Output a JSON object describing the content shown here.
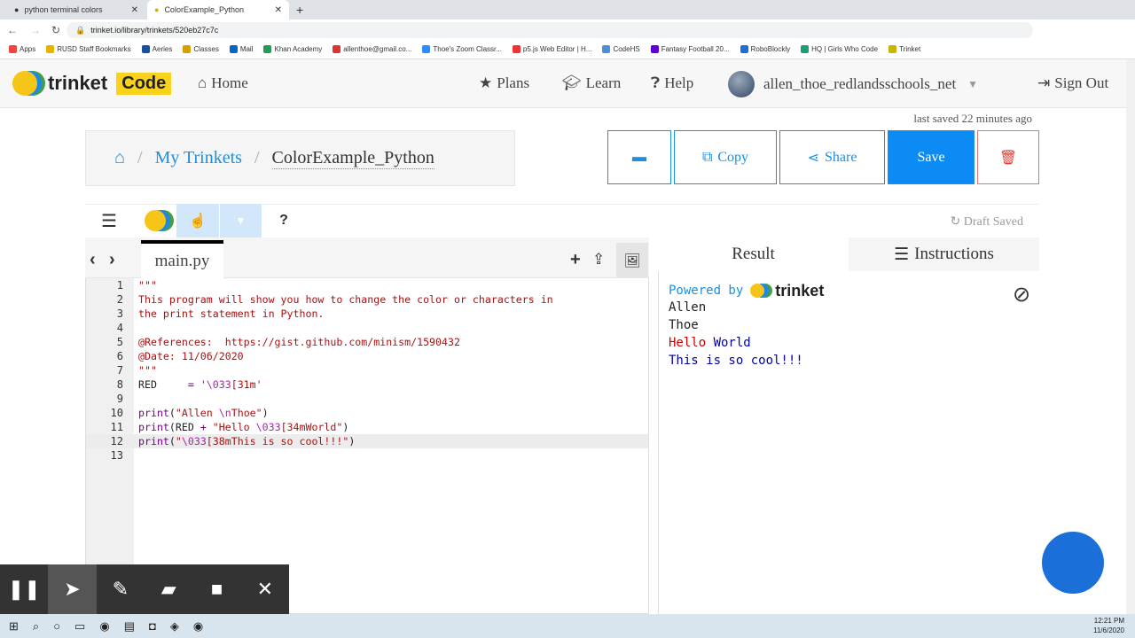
{
  "browser": {
    "tabs": [
      {
        "title": "python terminal colors",
        "icon": "github-icon"
      },
      {
        "title": "ColorExample_Python",
        "icon": "trinket-icon"
      }
    ],
    "url": "trinket.io/library/trinkets/520eb27c7c",
    "bookmarks": [
      "Apps",
      "RUSD Staff Bookmarks",
      "Aeries",
      "Classes",
      "Mail",
      "Khan Academy",
      "allenthoe@gmail.co...",
      "Thoe's Zoom Classr...",
      "p5.js Web Editor | H...",
      "CodeHS",
      "Fantasy Football 20...",
      "RoboBlockly",
      "HQ | Girls Who Code",
      "Trinket"
    ]
  },
  "header": {
    "logo": "trinket",
    "badge": "Code",
    "home": "Home",
    "plans": "Plans",
    "learn": "Learn",
    "help": "Help",
    "user": "allen_thoe_redlandsschools_net",
    "signout": "Sign Out"
  },
  "last_saved": "last saved 22 minutes ago",
  "breadcrumb": {
    "my": "My Trinkets",
    "current": "ColorExample_Python"
  },
  "actions": {
    "copy": "Copy",
    "share": "Share",
    "save": "Save"
  },
  "toolbar": {
    "help": "?",
    "draft": "Draft Saved"
  },
  "editor": {
    "file": "main.py",
    "highlighted_line": 12,
    "lines": [
      [
        [
          "s-str",
          "\"\"\""
        ]
      ],
      [
        [
          "s-str",
          "This program will show you how to change the color or characters in"
        ]
      ],
      [
        [
          "s-str",
          "the print statement in Python."
        ]
      ],
      [],
      [
        [
          "s-str",
          "@References:  https://gist.github.com/minism/1590432"
        ]
      ],
      [
        [
          "s-str",
          "@Date: 11/06/2020"
        ]
      ],
      [
        [
          "s-str",
          "\"\"\""
        ]
      ],
      [
        [
          "s-plain",
          "RED     "
        ],
        [
          "s-op",
          "= "
        ],
        [
          "s-str",
          "'"
        ],
        [
          "s-esc",
          "\\033"
        ],
        [
          "s-str",
          "[31m'"
        ]
      ],
      [],
      [
        [
          "s-kw",
          "print"
        ],
        [
          "s-plain",
          "("
        ],
        [
          "s-str",
          "\"Allen "
        ],
        [
          "s-esc",
          "\\n"
        ],
        [
          "s-str",
          "Thoe\""
        ],
        [
          "s-plain",
          ")"
        ]
      ],
      [
        [
          "s-kw",
          "print"
        ],
        [
          "s-plain",
          "(RED "
        ],
        [
          "s-op",
          "+"
        ],
        [
          "s-str",
          " \"Hello "
        ],
        [
          "s-esc",
          "\\033"
        ],
        [
          "s-str",
          "[34mWorld\""
        ],
        [
          "s-plain",
          ")"
        ]
      ],
      [
        [
          "s-kw",
          "print"
        ],
        [
          "s-plain",
          "("
        ],
        [
          "s-str",
          "\""
        ],
        [
          "s-esc",
          "\\033"
        ],
        [
          "s-str",
          "[38mThis is so cool!!!\""
        ],
        [
          "s-plain",
          ")"
        ]
      ],
      []
    ]
  },
  "result": {
    "tab_result": "Result",
    "tab_instructions": "Instructions",
    "powered": "Powered by",
    "brand": "trinket",
    "output": [
      {
        "text": "Allen",
        "color": "#222222"
      },
      {
        "text": "Thoe",
        "color": "#222222"
      },
      {
        "parts": [
          {
            "text": "Hello ",
            "color": "#cc0000"
          },
          {
            "text": "World",
            "color": "#0000aa"
          }
        ]
      },
      {
        "text": "This is so cool!!!",
        "color": "#0000aa"
      }
    ]
  },
  "taskbar": {
    "time": "12:21 PM",
    "date": "11/6/2020"
  }
}
